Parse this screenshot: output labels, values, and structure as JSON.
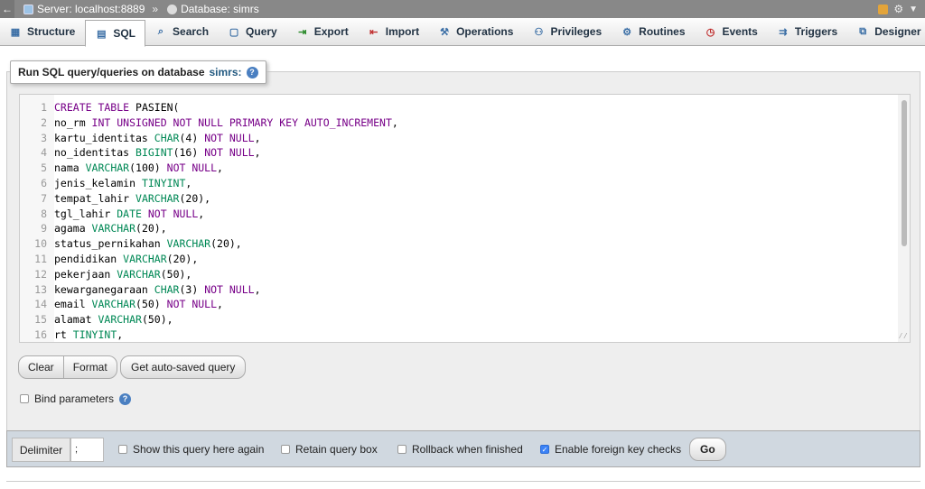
{
  "breadcrumb": {
    "back": "←",
    "server": "Server: localhost:8889",
    "separator": "»",
    "database": "Database: simrs"
  },
  "tabs": [
    {
      "label": "Structure",
      "icon": "structure-icon"
    },
    {
      "label": "SQL",
      "icon": "sql-icon"
    },
    {
      "label": "Search",
      "icon": "search-icon"
    },
    {
      "label": "Query",
      "icon": "query-icon"
    },
    {
      "label": "Export",
      "icon": "export-icon"
    },
    {
      "label": "Import",
      "icon": "import-icon"
    },
    {
      "label": "Operations",
      "icon": "wrench-icon"
    },
    {
      "label": "Privileges",
      "icon": "privileges-icon"
    },
    {
      "label": "Routines",
      "icon": "routines-icon"
    },
    {
      "label": "Events",
      "icon": "clock-icon"
    },
    {
      "label": "Triggers",
      "icon": "triggers-icon"
    },
    {
      "label": "Designer",
      "icon": "designer-icon"
    }
  ],
  "active_tab": "SQL",
  "panel": {
    "legend_prefix": "Run SQL query/queries on database",
    "database_name": "simrs:"
  },
  "editor": {
    "lines": [
      [
        {
          "t": "CREATE TABLE ",
          "c": "kw"
        },
        {
          "t": "PASIEN(",
          "c": ""
        }
      ],
      [
        {
          "t": "no_rm ",
          "c": ""
        },
        {
          "t": "INT UNSIGNED NOT NULL PRIMARY KEY AUTO_INCREMENT",
          "c": "kw"
        },
        {
          "t": ",",
          "c": ""
        }
      ],
      [
        {
          "t": "kartu_identitas ",
          "c": ""
        },
        {
          "t": "CHAR",
          "c": "ty"
        },
        {
          "t": "(4) ",
          "c": ""
        },
        {
          "t": "NOT NULL",
          "c": "kw"
        },
        {
          "t": ",",
          "c": ""
        }
      ],
      [
        {
          "t": "no_identitas ",
          "c": ""
        },
        {
          "t": "BIGINT",
          "c": "ty"
        },
        {
          "t": "(16) ",
          "c": ""
        },
        {
          "t": "NOT NULL",
          "c": "kw"
        },
        {
          "t": ",",
          "c": ""
        }
      ],
      [
        {
          "t": "nama ",
          "c": ""
        },
        {
          "t": "VARCHAR",
          "c": "ty"
        },
        {
          "t": "(100) ",
          "c": ""
        },
        {
          "t": "NOT NULL",
          "c": "kw"
        },
        {
          "t": ",",
          "c": ""
        }
      ],
      [
        {
          "t": "jenis_kelamin ",
          "c": ""
        },
        {
          "t": "TINYINT",
          "c": "ty"
        },
        {
          "t": ",",
          "c": ""
        }
      ],
      [
        {
          "t": "tempat_lahir ",
          "c": ""
        },
        {
          "t": "VARCHAR",
          "c": "ty"
        },
        {
          "t": "(20),",
          "c": ""
        }
      ],
      [
        {
          "t": "tgl_lahir ",
          "c": ""
        },
        {
          "t": "DATE ",
          "c": "ty"
        },
        {
          "t": "NOT NULL",
          "c": "kw"
        },
        {
          "t": ",",
          "c": ""
        }
      ],
      [
        {
          "t": "agama ",
          "c": ""
        },
        {
          "t": "VARCHAR",
          "c": "ty"
        },
        {
          "t": "(20),",
          "c": ""
        }
      ],
      [
        {
          "t": "status_pernikahan ",
          "c": ""
        },
        {
          "t": "VARCHAR",
          "c": "ty"
        },
        {
          "t": "(20),",
          "c": ""
        }
      ],
      [
        {
          "t": "pendidikan ",
          "c": ""
        },
        {
          "t": "VARCHAR",
          "c": "ty"
        },
        {
          "t": "(20),",
          "c": ""
        }
      ],
      [
        {
          "t": "pekerjaan ",
          "c": ""
        },
        {
          "t": "VARCHAR",
          "c": "ty"
        },
        {
          "t": "(50),",
          "c": ""
        }
      ],
      [
        {
          "t": "kewarganegaraan ",
          "c": ""
        },
        {
          "t": "CHAR",
          "c": "ty"
        },
        {
          "t": "(3) ",
          "c": ""
        },
        {
          "t": "NOT NULL",
          "c": "kw"
        },
        {
          "t": ",",
          "c": ""
        }
      ],
      [
        {
          "t": "email ",
          "c": ""
        },
        {
          "t": "VARCHAR",
          "c": "ty"
        },
        {
          "t": "(50) ",
          "c": ""
        },
        {
          "t": "NOT NULL",
          "c": "kw"
        },
        {
          "t": ",",
          "c": ""
        }
      ],
      [
        {
          "t": "alamat ",
          "c": ""
        },
        {
          "t": "VARCHAR",
          "c": "ty"
        },
        {
          "t": "(50),",
          "c": ""
        }
      ],
      [
        {
          "t": "rt ",
          "c": ""
        },
        {
          "t": "TINYINT",
          "c": "ty"
        },
        {
          "t": ",",
          "c": ""
        }
      ]
    ]
  },
  "buttons": {
    "clear": "Clear",
    "format": "Format",
    "autosaved": "Get auto-saved query",
    "go": "Go"
  },
  "options": {
    "bind_parameters": "Bind parameters",
    "show_query": "Show this query here again",
    "retain_box": "Retain query box",
    "rollback": "Rollback when finished",
    "foreign_keys": "Enable foreign key checks"
  },
  "delimiter": {
    "label": "Delimiter",
    "value": ";"
  },
  "colors": {
    "keyword": "#770088",
    "type": "#008855",
    "accent": "#235a81"
  }
}
